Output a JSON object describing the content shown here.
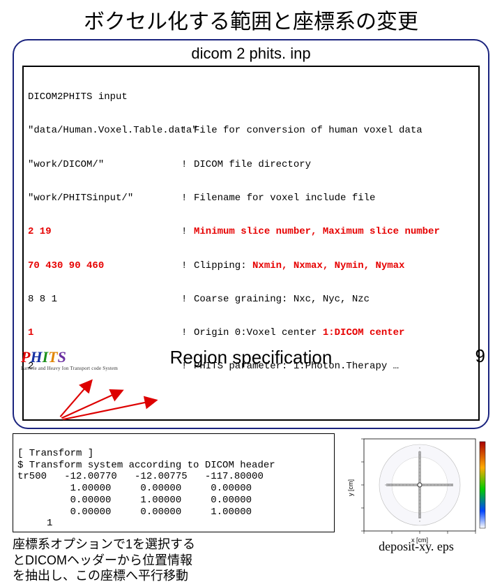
{
  "title": "ボクセル化する範囲と座標系の変更",
  "file_label": "dicom 2 phits. inp",
  "code": {
    "header": "DICOM2PHITS input",
    "rows": [
      {
        "lhs": "\"data/Human.Voxel.Table.data\"",
        "rhs": "File for conversion of human voxel data"
      },
      {
        "lhs": "\"work/DICOM/\"",
        "rhs": "DICOM file directory"
      },
      {
        "lhs": "\"work/PHITSinput/\"",
        "rhs": "Filename for voxel include file"
      },
      {
        "lhs": "2 19",
        "rhs_prefix": "",
        "rhs_red": "Minimum slice number, Maximum slice number",
        "lhs_red": true
      },
      {
        "lhs": "70 430 90 460",
        "rhs_prefix": "Clipping: ",
        "rhs_red": "Nxmin, Nxmax, Nymin, Nymax",
        "lhs_red": true
      },
      {
        "lhs": "8 8 1",
        "rhs": "Coarse graining: Nxc, Nyc, Nzc"
      },
      {
        "lhs": "1",
        "rhs_prefix": "Origin 0:Voxel center ",
        "rhs_red": "1:DICOM center",
        "lhs_red": true
      },
      {
        "lhs": "2",
        "rhs": "PHITS parameter: 1:Photon.Therapy …"
      }
    ]
  },
  "transform": {
    "l1": "[ Transform ]",
    "l2": "$ Transform system according to DICOM header",
    "l3": "tr500   -12.00770   -12.00775   -117.80000",
    "l4": "         1.00000     0.00000     0.00000",
    "l5": "         0.00000     1.00000     0.00000",
    "l6": "         0.00000     0.00000     1.00000",
    "l7": "     1"
  },
  "note": {
    "l1": "座標系オプションで1を選択する",
    "l2": "とDICOMヘッダーから位置情報",
    "l3": "を抽出し、この座標へ平行移動"
  },
  "figure_caption": "deposit-xy. eps",
  "footer_title": "Region specification",
  "page_number": "9",
  "axis": {
    "xlabel": "x [cm]",
    "ylabel": "y [cm]"
  }
}
